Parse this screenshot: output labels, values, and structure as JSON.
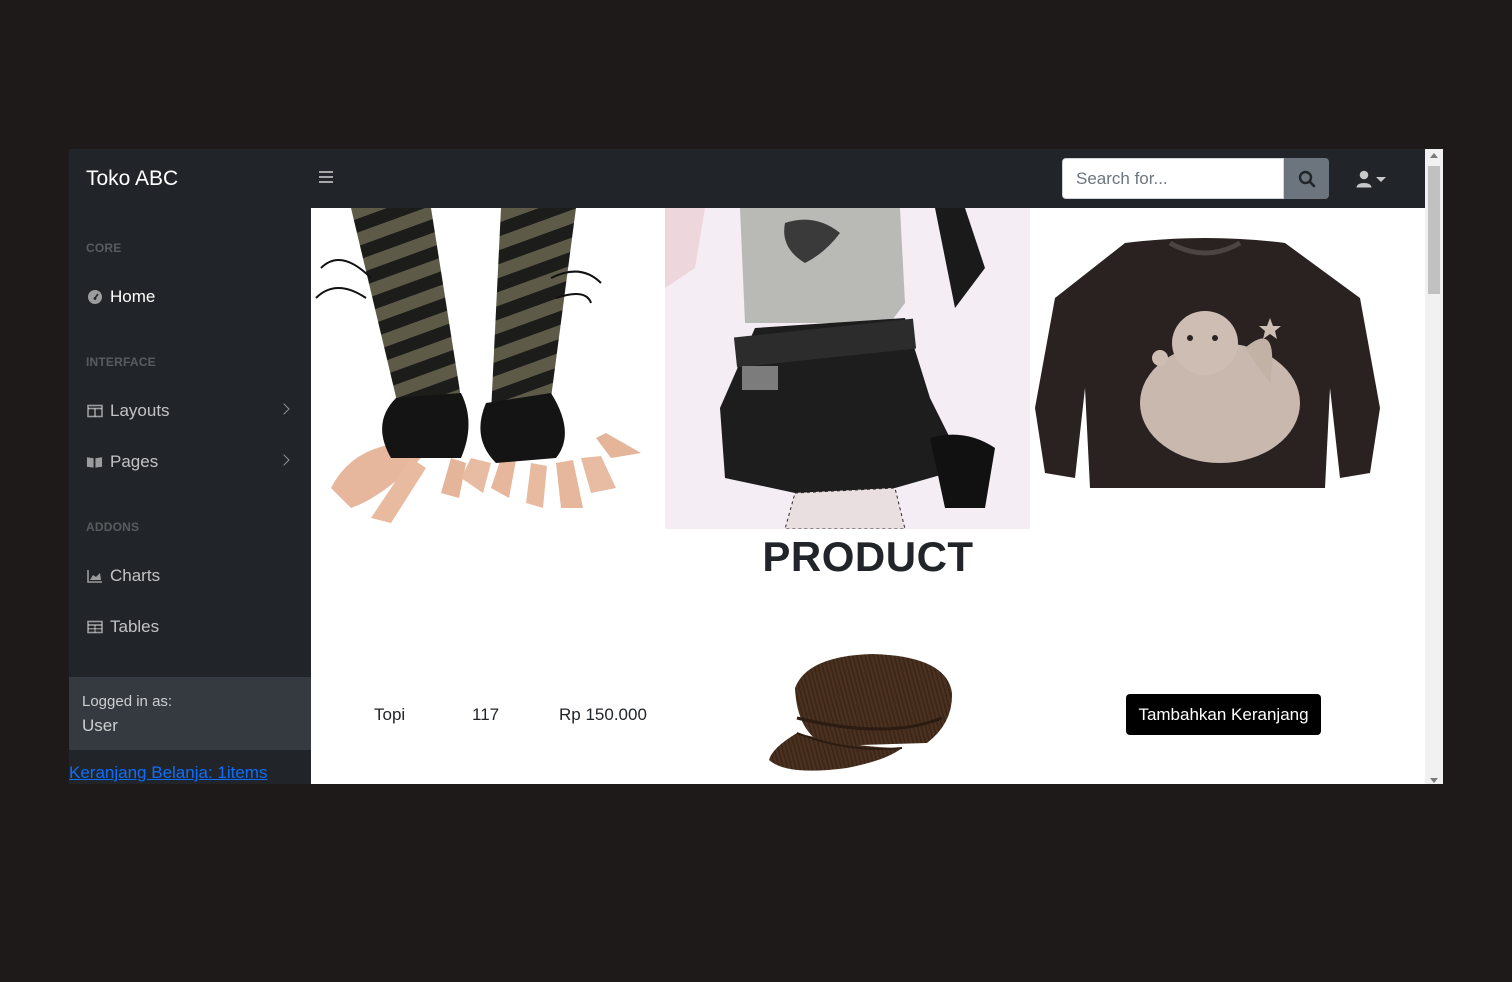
{
  "navbar": {
    "brand": "Toko ABC",
    "search_placeholder": "Search for...",
    "toggle_icon": "bars-icon",
    "search_icon": "search-icon",
    "user_icon": "user-icon"
  },
  "sidebar": {
    "sections": [
      {
        "heading": "CORE",
        "items": [
          {
            "label": "Home",
            "icon": "tachometer-icon",
            "has_submenu": false
          }
        ]
      },
      {
        "heading": "INTERFACE",
        "items": [
          {
            "label": "Layouts",
            "icon": "columns-icon",
            "has_submenu": true
          },
          {
            "label": "Pages",
            "icon": "book-open-icon",
            "has_submenu": true
          }
        ]
      },
      {
        "heading": "ADDONS",
        "items": [
          {
            "label": "Charts",
            "icon": "chart-area-icon",
            "has_submenu": false
          },
          {
            "label": "Tables",
            "icon": "table-icon",
            "has_submenu": false
          }
        ]
      }
    ],
    "footer": {
      "caption": "Logged in as:",
      "user": "User"
    },
    "cart_link": "Keranjang Belanja: 1items"
  },
  "main": {
    "banner_images": [
      "knit-arm-warmers-image",
      "scorpion-top-skirt-image",
      "angel-sweater-image"
    ],
    "heading": "PRODUCT",
    "products": [
      {
        "name": "Topi",
        "stock": "117",
        "price": "Rp 150.000",
        "image": "corduroy-cap-image",
        "button": "Tambahkan Keranjang"
      }
    ]
  },
  "colors": {
    "navbar_bg": "#212529",
    "footer_bg": "#343a40",
    "link": "#0d6efd",
    "button_bg": "#000000",
    "page_bg": "#1f1a1a"
  }
}
